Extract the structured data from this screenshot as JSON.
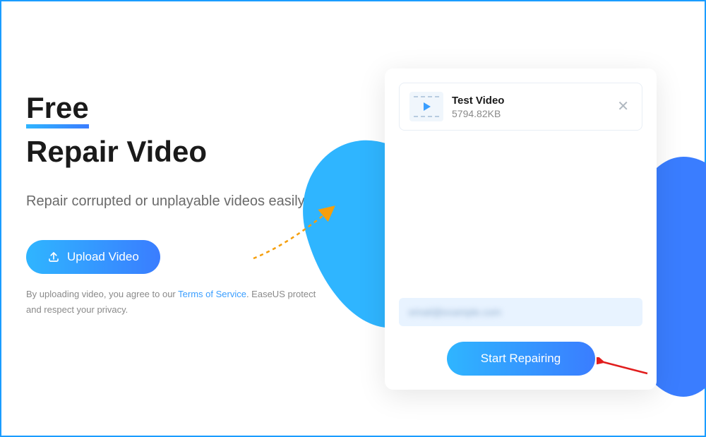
{
  "heading": {
    "line1": "Free",
    "line2": "Repair Video"
  },
  "subtitle": "Repair corrupted or unplayable videos easily.",
  "upload_button": {
    "label": "Upload Video"
  },
  "terms": {
    "prefix": "By uploading video, you agree to our ",
    "link_text": "Terms of Service",
    "suffix": ". EaseUS protect and respect your privacy."
  },
  "file": {
    "name": "Test Video",
    "size": "5794.82KB"
  },
  "email_field": {
    "blurred_placeholder": "email@example.com"
  },
  "start_button": {
    "label": "Start Repairing"
  }
}
